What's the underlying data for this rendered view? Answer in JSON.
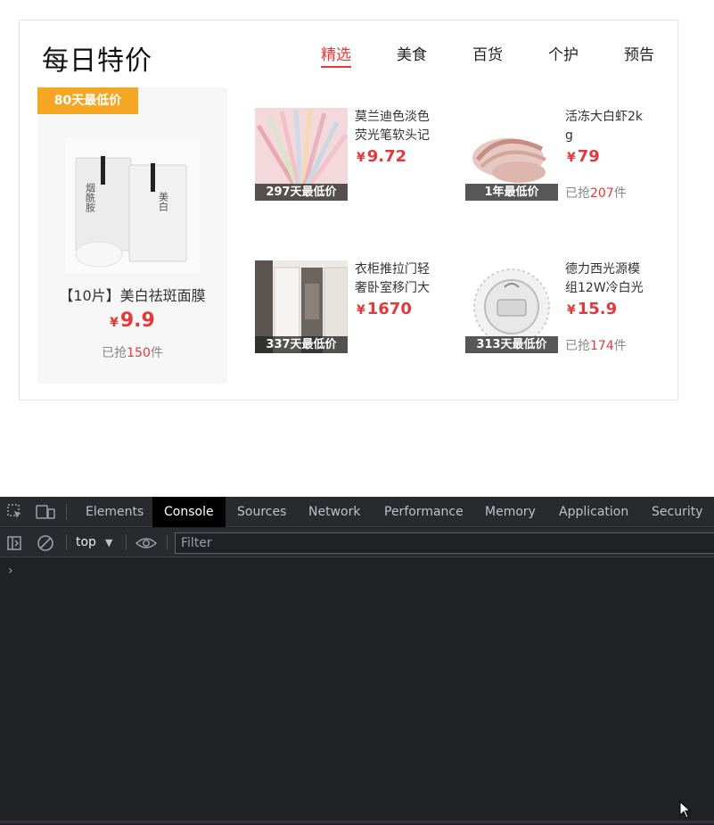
{
  "panel": {
    "title": "每日特价",
    "tabs": [
      {
        "label": "精选",
        "active": true
      },
      {
        "label": "美食",
        "active": false
      },
      {
        "label": "百货",
        "active": false
      },
      {
        "label": "个护",
        "active": false
      },
      {
        "label": "预告",
        "active": false
      }
    ],
    "hero": {
      "badge": "80天最低价",
      "name": "【10片】美白祛斑面膜",
      "currency": "¥",
      "price": "9.9",
      "sold_prefix": "已抢",
      "sold_count": "150",
      "sold_suffix": "件"
    },
    "items": [
      {
        "name": "莫兰迪色淡色荧光笔软头记",
        "currency": "¥",
        "price": "9.72",
        "label": "297天最低价",
        "sold_prefix": "",
        "sold_count": "",
        "sold_suffix": ""
      },
      {
        "name": "活冻大白虾2kg",
        "currency": "¥",
        "price": "79",
        "label": "1年最低价",
        "sold_prefix": "已抢",
        "sold_count": "207",
        "sold_suffix": "件"
      },
      {
        "name": "衣柜推拉门轻奢卧室移门大",
        "currency": "¥",
        "price": "1670",
        "label": "337天最低价",
        "sold_prefix": "",
        "sold_count": "",
        "sold_suffix": ""
      },
      {
        "name": "德力西光源模组12W冷白光",
        "currency": "¥",
        "price": "15.9",
        "label": "313天最低价",
        "sold_prefix": "已抢",
        "sold_count": "174",
        "sold_suffix": "件"
      }
    ],
    "colors": {
      "accent": "#e4393c",
      "badge": "#f5a623"
    }
  },
  "devtools": {
    "tabs": [
      {
        "label": "Elements",
        "active": false
      },
      {
        "label": "Console",
        "active": true
      },
      {
        "label": "Sources",
        "active": false
      },
      {
        "label": "Network",
        "active": false
      },
      {
        "label": "Performance",
        "active": false
      },
      {
        "label": "Memory",
        "active": false
      },
      {
        "label": "Application",
        "active": false
      },
      {
        "label": "Security",
        "active": false
      }
    ],
    "context": "top",
    "filter_placeholder": "Filter",
    "prompt": "›",
    "icons": [
      "inspect-element-icon",
      "device-toolbar-icon",
      "sidebar-toggle-icon",
      "clear-console-icon",
      "eye-icon",
      "dropdown-arrow-icon"
    ]
  }
}
